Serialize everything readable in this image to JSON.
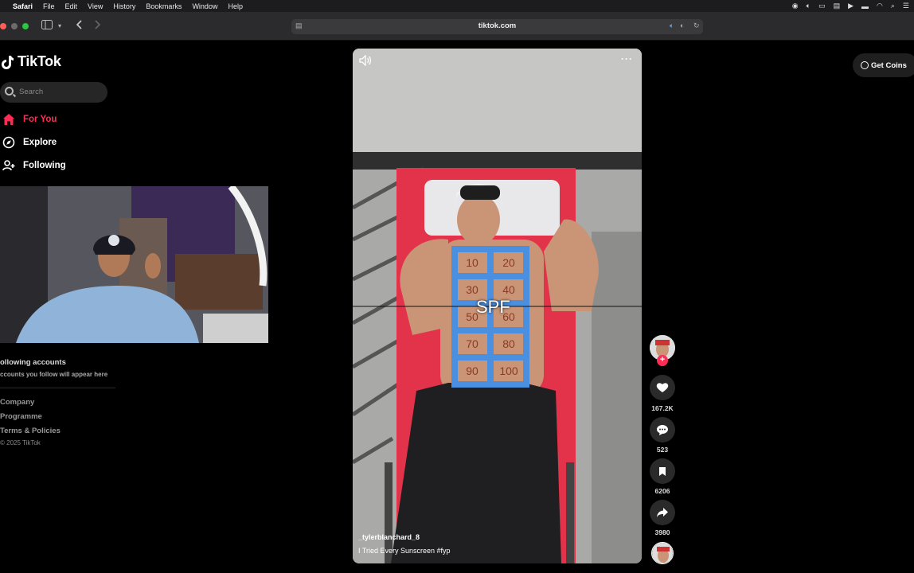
{
  "menubar": {
    "app": "Safari",
    "items": [
      "File",
      "Edit",
      "View",
      "History",
      "Bookmarks",
      "Window",
      "Help"
    ]
  },
  "browser": {
    "url": "tiktok.com"
  },
  "sidebar": {
    "logo_text": "TikTok",
    "search_placeholder": "Search",
    "nav": [
      {
        "label": "For You",
        "icon": "home-icon",
        "active": true
      },
      {
        "label": "Explore",
        "icon": "compass-icon",
        "active": false
      },
      {
        "label": "Following",
        "icon": "user-plus-icon",
        "active": false
      }
    ],
    "following_title": "ollowing accounts",
    "following_sub": "ccounts you follow will appear here",
    "footer_links": [
      "Company",
      "Programme",
      "Terms & Policies"
    ],
    "copyright": "© 2025 TikTok"
  },
  "header": {
    "get_coins": "Get Coins"
  },
  "video": {
    "caption_overlay": "SPF",
    "author": "_tylerblanchard_8",
    "description": "I Tried Every Sunscreen #fyp",
    "grid_labels": [
      "10",
      "20",
      "30",
      "40",
      "50",
      "60",
      "70",
      "80",
      "90",
      "100"
    ]
  },
  "actions": {
    "likes": "167.2K",
    "comments": "523",
    "saves": "6206",
    "shares": "3980"
  },
  "colors": {
    "accent": "#fe2c55",
    "tape": "#4a8fe0",
    "lounger": "#e2334a"
  }
}
